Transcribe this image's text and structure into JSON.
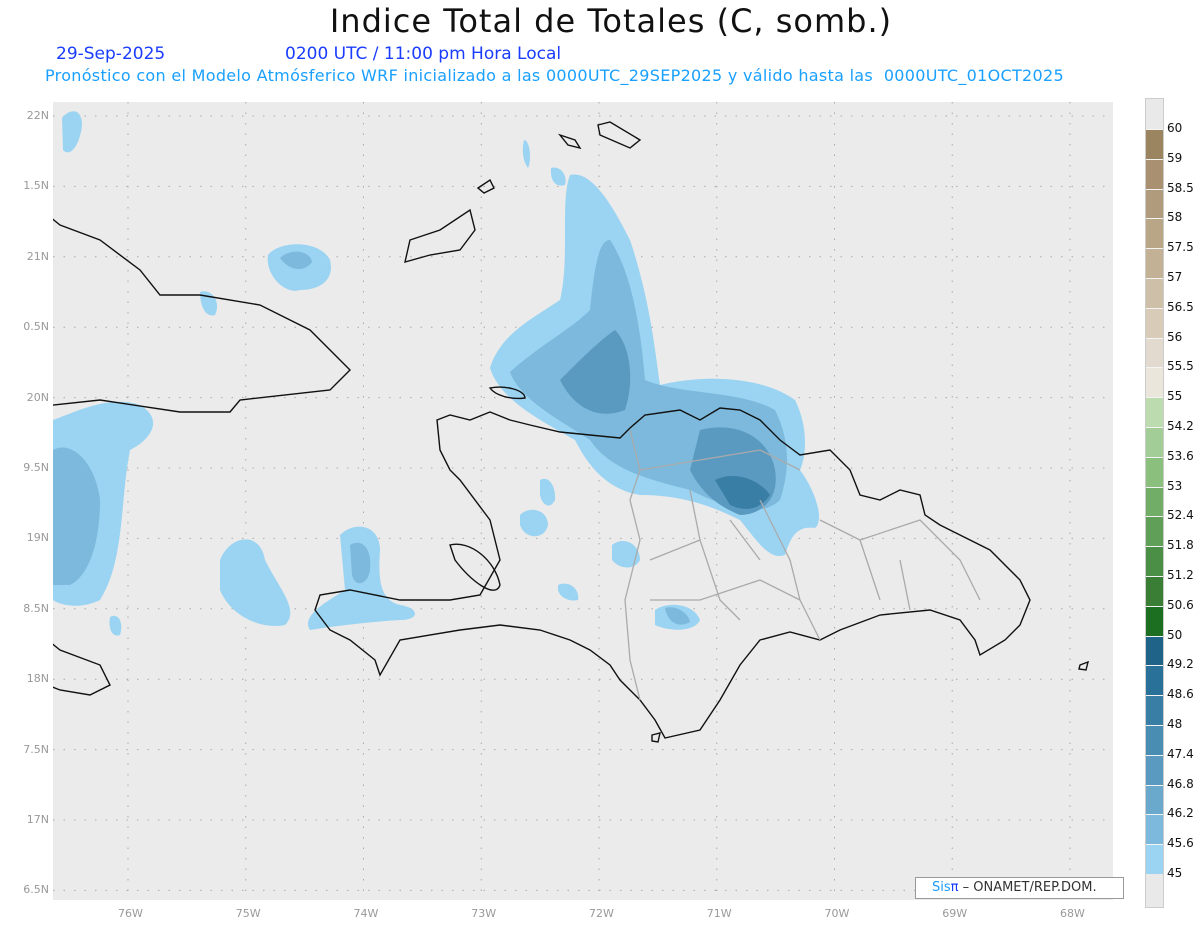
{
  "header": {
    "title": "Indice Total de Totales (C, somb.)",
    "date": "29-Sep-2025",
    "time": "0200 UTC / 11:00 pm Hora Local",
    "description": "Pronóstico con el Modelo Atmósferico WRF inicializado a las 0000UTC_29SEP2025 y válido hasta las  0000UTC_01OCT2025"
  },
  "axes": {
    "lat_labels": [
      "22N",
      "1.5N",
      "21N",
      "0.5N",
      "20N",
      "9.5N",
      "19N",
      "8.5N",
      "18N",
      "7.5N",
      "17N",
      "6.5N"
    ],
    "lon_labels": [
      "76W",
      "75W",
      "74W",
      "73W",
      "72W",
      "71W",
      "70W",
      "69W",
      "68W"
    ]
  },
  "colorbar": {
    "labels": [
      "60",
      "59",
      "58.5",
      "58",
      "57.5",
      "57",
      "56.5",
      "56",
      "55.5",
      "55",
      "54.2",
      "53.6",
      "53",
      "52.4",
      "51.8",
      "51.2",
      "50.6",
      "50",
      "49.2",
      "48.6",
      "48",
      "47.4",
      "46.8",
      "46.2",
      "45.6",
      "45"
    ],
    "colors": [
      "#9b8560",
      "#a89070",
      "#b09c7c",
      "#b8a686",
      "#c2b194",
      "#cdbfa8",
      "#d8ccb8",
      "#e2dace",
      "#ebe6dc",
      "#bcdcb0",
      "#a3cd96",
      "#8abf7e",
      "#72ad68",
      "#5f9f57",
      "#4b8f46",
      "#3a7e35",
      "#1c6e20",
      "#1f6488",
      "#2a7199",
      "#387ea5",
      "#4a8db2",
      "#5b9ac0",
      "#6aa8cc",
      "#7cb9dc",
      "#9ad4f2"
    ]
  },
  "credit": {
    "brand": "Sis",
    "pi": "π",
    "text": "– ONAMET/REP.DOM."
  }
}
